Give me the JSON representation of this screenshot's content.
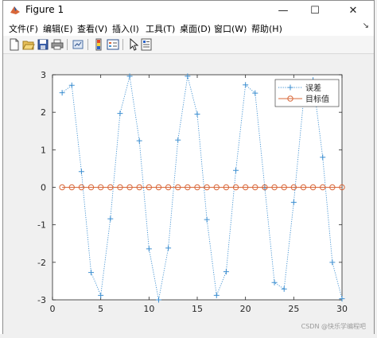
{
  "window": {
    "title": "Figure 1",
    "minimize_glyph": "—",
    "maximize_glyph": "☐",
    "close_glyph": "✕"
  },
  "menu": {
    "items": [
      "文件(F)",
      "编辑(E)",
      "查看(V)",
      "插入(I)",
      "工具(T)",
      "桌面(D)",
      "窗口(W)",
      "帮助(H)"
    ],
    "chevron": "↘"
  },
  "toolbar": {
    "icons": [
      "new-figure-icon",
      "open-file-icon",
      "save-icon",
      "print-icon",
      "link-plot-icon",
      "insert-colorbar-icon",
      "insert-legend-icon",
      "edit-plot-icon",
      "property-inspector-icon"
    ]
  },
  "chart_data": {
    "type": "line",
    "title": "",
    "xlabel": "",
    "ylabel": "",
    "xlim": [
      0,
      30
    ],
    "ylim": [
      -3,
      3
    ],
    "xticks": [
      "0",
      "5",
      "10",
      "15",
      "20",
      "25",
      "30"
    ],
    "yticks": [
      "3",
      "2",
      "1",
      "0",
      "-1",
      "-2",
      "-3"
    ],
    "grid": false,
    "legend_position": "top-right",
    "x": [
      1,
      2,
      3,
      4,
      5,
      6,
      7,
      8,
      9,
      10,
      11,
      12,
      13,
      14,
      15,
      16,
      17,
      18,
      19,
      20,
      21,
      22,
      23,
      24,
      25,
      26,
      27,
      28,
      29,
      30
    ],
    "series": [
      {
        "name": "误差",
        "color": "#3d8fd1",
        "line_style": "dotted",
        "marker": "plus",
        "values": [
          2.52,
          2.72,
          0.42,
          -2.27,
          -2.88,
          -0.84,
          1.97,
          2.96,
          1.24,
          -1.64,
          -3.0,
          -1.62,
          1.26,
          2.96,
          1.95,
          -0.86,
          -2.88,
          -2.25,
          0.45,
          2.73,
          2.51,
          -0.01,
          -2.54,
          -2.71,
          -0.4,
          2.28,
          2.86,
          0.8,
          -2.0,
          -2.97
        ]
      },
      {
        "name": "目标值",
        "color": "#d9683a",
        "line_style": "solid",
        "marker": "circle",
        "values": [
          0,
          0,
          0,
          0,
          0,
          0,
          0,
          0,
          0,
          0,
          0,
          0,
          0,
          0,
          0,
          0,
          0,
          0,
          0,
          0,
          0,
          0,
          0,
          0,
          0,
          0,
          0,
          0,
          0,
          0
        ]
      }
    ]
  },
  "watermark": "CSDN @快乐学编程吧"
}
